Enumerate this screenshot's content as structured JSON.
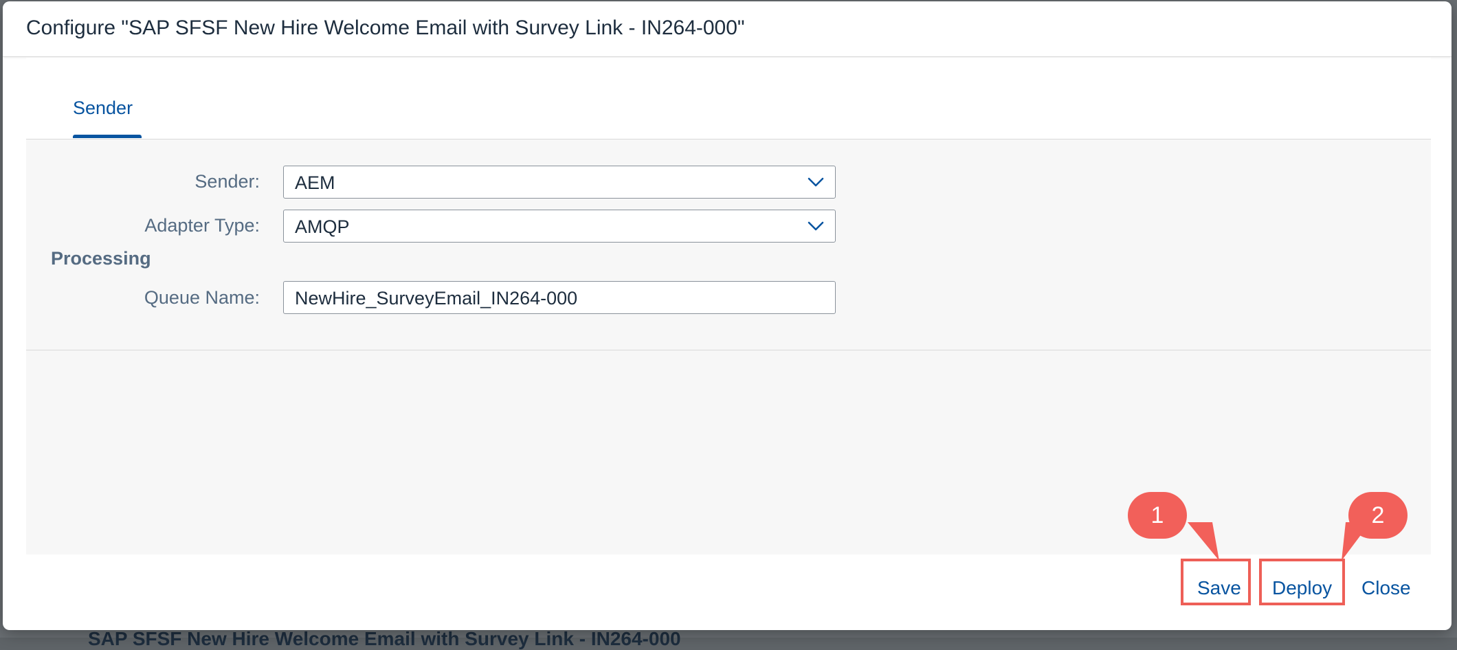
{
  "dialog": {
    "title": "Configure \"SAP SFSF New Hire Welcome Email with Survey Link - IN264-000\""
  },
  "tabs": [
    {
      "label": "Sender",
      "active": true
    }
  ],
  "form": {
    "sender_label": "Sender:",
    "sender_value": "AEM",
    "adapter_label": "Adapter Type:",
    "adapter_value": "AMQP",
    "processing_heading": "Processing",
    "queue_label": "Queue Name:",
    "queue_value": "NewHire_SurveyEmail_IN264-000"
  },
  "footer": {
    "save_label": "Save",
    "deploy_label": "Deploy",
    "close_label": "Close"
  },
  "annotations": {
    "callout_1": "1",
    "callout_2": "2",
    "color": "#ee5f57"
  },
  "background": {
    "partial_text": "SAP SFSF New Hire Welcome Email with Survey Link - IN264-000"
  },
  "colors": {
    "accent": "#0854a0",
    "label": "#556b82",
    "text": "#1d2d3e"
  }
}
